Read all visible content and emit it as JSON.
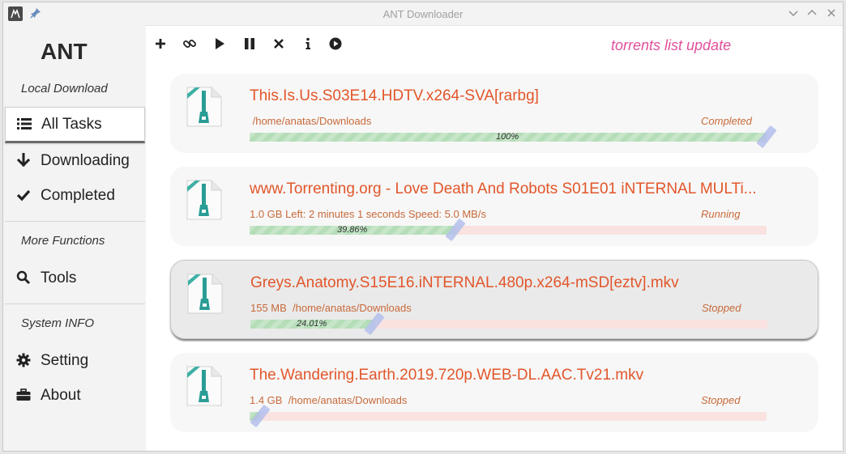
{
  "window": {
    "title": "ANT Downloader"
  },
  "sidebar": {
    "brand": "ANT",
    "sections": [
      "Local Download",
      "More Functions",
      "System INFO"
    ],
    "items": [
      {
        "label": "All Tasks",
        "icon": "list-icon",
        "active": true
      },
      {
        "label": "Downloading",
        "icon": "arrow-down-icon"
      },
      {
        "label": "Completed",
        "icon": "check-icon"
      },
      {
        "label": "Tools",
        "icon": "search-icon"
      },
      {
        "label": "Setting",
        "icon": "gear-icon"
      },
      {
        "label": "About",
        "icon": "briefcase-icon"
      }
    ]
  },
  "toolbar": {
    "buttons": [
      "add-icon",
      "link-icon",
      "play-icon",
      "pause-icon",
      "close-icon",
      "info-icon",
      "play-circle-icon"
    ],
    "status_message": "torrents list update"
  },
  "tasks": [
    {
      "name": "This.Is.Us.S03E14.HDTV.x264-SVA[rarbg]",
      "info": " /home/anatas/Downloads",
      "status": "Completed",
      "progress_label": "100%",
      "progress": 1.0
    },
    {
      "name": "www.Torrenting.org - Love Death And Robots S01E01 iNTERNAL MULTi...",
      "info": "1.0 GB Left: 2 minutes 1 seconds Speed: 5.0 MB/s",
      "status": "Running",
      "progress_label": "39.86%",
      "progress": 0.3986
    },
    {
      "name": "Greys.Anatomy.S15E16.iNTERNAL.480p.x264-mSD[eztv].mkv",
      "info": "155 MB  /home/anatas/Downloads",
      "status": "Stopped",
      "progress_label": "24.01%",
      "progress": 0.2401,
      "selected": true
    },
    {
      "name": "The.Wandering.Earth.2019.720p.WEB-DL.AAC.Tv21.mkv",
      "info": "1.4 GB  /home/anatas/Downloads",
      "status": "Stopped",
      "progress_label": "",
      "progress": 0.02
    }
  ],
  "colors": {
    "accent": "#e2562a",
    "status_message": "#e0509b",
    "progress_fill": "#c7e6c9",
    "progress_track": "#f9e2e0"
  }
}
